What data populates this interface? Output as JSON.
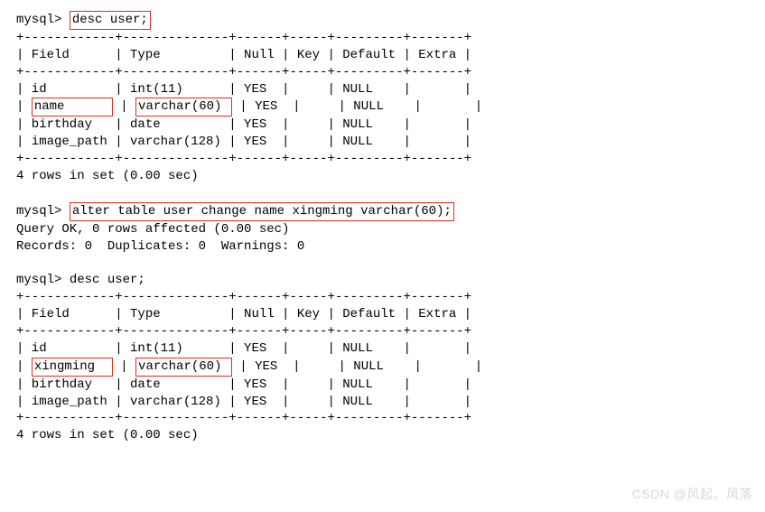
{
  "block1": {
    "prompt": "mysql> ",
    "cmd": "desc user;",
    "sep": "+------------+--------------+------+-----+---------+-------+",
    "header": "| Field      | Type         | Null | Key | Default | Extra |",
    "row1": "| id         | int(11)      | YES  |     | NULL    |       |",
    "row2_pre": "| ",
    "row2_field": "name      ",
    "row2_mid": " | ",
    "row2_type": "varchar(60) ",
    "row2_post": " | YES  |     | NULL    |       |",
    "row3": "| birthday   | date         | YES  |     | NULL    |       |",
    "row4": "| image_path | varchar(128) | YES  |     | NULL    |       |",
    "result": "4 rows in set (0.00 sec)"
  },
  "block2": {
    "prompt": "mysql> ",
    "cmd": "alter table user change name xingming varchar(60);",
    "line1": "Query OK, 0 rows affected (0.00 sec)",
    "line2": "Records: 0  Duplicates: 0  Warnings: 0"
  },
  "block3": {
    "prompt": "mysql> ",
    "cmd": "desc user;",
    "sep": "+------------+--------------+------+-----+---------+-------+",
    "header": "| Field      | Type         | Null | Key | Default | Extra |",
    "row1": "| id         | int(11)      | YES  |     | NULL    |       |",
    "row2_pre": "| ",
    "row2_field": "xingming  ",
    "row2_mid": " | ",
    "row2_type": "varchar(60) ",
    "row2_post": " | YES  |     | NULL    |       |",
    "row3": "| birthday   | date         | YES  |     | NULL    |       |",
    "row4": "| image_path | varchar(128) | YES  |     | NULL    |       |",
    "result": "4 rows in set (0.00 sec)"
  },
  "watermark": "CSDN @风起、风落"
}
